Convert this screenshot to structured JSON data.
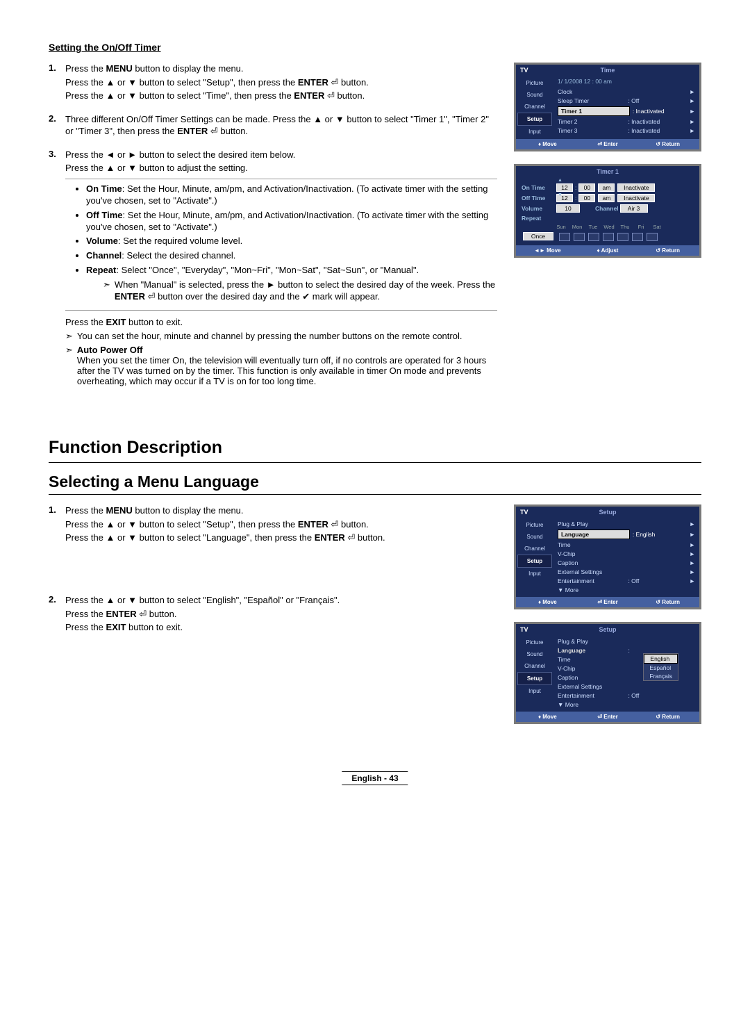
{
  "headings": {
    "setting_timer": "Setting the On/Off Timer",
    "function_description": "Function Description",
    "selecting_language": "Selecting a Menu Language"
  },
  "symbols": {
    "up": "▲",
    "down": "▼",
    "left": "◄",
    "right": "►",
    "enter": "⏎",
    "check": "✔",
    "note": "➣"
  },
  "timer_steps": {
    "s1_num": "1.",
    "s1_l1a": "Press the ",
    "s1_l1b": "MENU",
    "s1_l1c": " button to display the menu.",
    "s1_l2a": "Press the ▲ or ▼ button to select \"Setup\", then press the ",
    "s1_l2b": "ENTER",
    "s1_l2c": " ⏎ button.",
    "s1_l3a": "Press the ▲ or ▼ button to select \"Time\", then press the ",
    "s1_l3b": "ENTER",
    "s1_l3c": " ⏎ button.",
    "s2_num": "2.",
    "s2_l1": "Three different On/Off Timer Settings can be made. Press the ▲ or ▼ button to select \"Timer 1\", \"Timer 2\" or \"Timer 3\", then press the ",
    "s2_l1b": "ENTER",
    "s2_l1c": " ⏎ button.",
    "s3_num": "3.",
    "s3_l1": "Press the ◄ or ► button to select the desired item below.",
    "s3_l2": "Press the ▲ or ▼ button to adjust the setting."
  },
  "options": {
    "on_time_b": "On Time",
    "on_time": ": Set the Hour, Minute, am/pm, and Activation/Inactivation. (To activate timer with the setting you've chosen, set to \"Activate\".)",
    "off_time_b": "Off Time",
    "off_time": ": Set the Hour, Minute, am/pm, and Activation/Inactivation. (To activate timer with the setting you've chosen, set to \"Activate\".)",
    "volume_b": "Volume",
    "volume": ": Set the required volume level.",
    "channel_b": "Channel",
    "channel": ": Select the desired channel.",
    "repeat_b": "Repeat",
    "repeat": ": Select \"Once\", \"Everyday\", \"Mon~Fri\", \"Mon~Sat\", \"Sat~Sun\", or \"Manual\".",
    "manual_note": "When \"Manual\" is selected, press the ► button to select the desired day of the week. Press the ",
    "manual_note_b": "ENTER",
    "manual_note_c": " ⏎ button over the desired day and the ✔ mark will appear."
  },
  "after_box": {
    "exit_a": "Press the ",
    "exit_b": "EXIT",
    "exit_c": " button to exit.",
    "note1": "You can set the hour, minute and channel by pressing the number buttons on the remote control.",
    "auto_b": "Auto Power Off",
    "auto": "When you set the timer On, the television will eventually turn off, if no controls are operated for 3 hours after the TV was turned on by the timer. This function is only available in timer On mode and prevents overheating, which may occur if a TV is on for too long time."
  },
  "lang_steps": {
    "s1_num": "1.",
    "s1_l1a": "Press the ",
    "s1_l1b": "MENU",
    "s1_l1c": " button to display the menu.",
    "s1_l2a": "Press the ▲ or ▼ button to select \"Setup\", then press the ",
    "s1_l2b": "ENTER",
    "s1_l2c": " ⏎ button.",
    "s1_l3a": "Press the ▲ or ▼ button to select \"Language\", then press the ",
    "s1_l3b": "ENTER",
    "s1_l3c": " ⏎ button.",
    "s2_num": "2.",
    "s2_l1": "Press the ▲ or ▼ button to select \"English\", \"Español\" or \"Français\".",
    "s2_l2a": "Press the ",
    "s2_l2b": "ENTER",
    "s2_l2c": " ⏎ button.",
    "s2_l3a": "Press the ",
    "s2_l3b": "EXIT",
    "s2_l3c": " button to exit."
  },
  "osd_common": {
    "tv": "TV",
    "sidebar": [
      "Picture",
      "Sound",
      "Channel",
      "Setup",
      "Input"
    ],
    "foot_move": "Move",
    "foot_enter": "Enter",
    "foot_return": "Return",
    "foot_adjust": "Adjust",
    "foot_move_sym1": "♦",
    "foot_move_sym2": "◄►",
    "foot_enter_sym": "⏎",
    "foot_return_sym": "↺"
  },
  "osd_time": {
    "title": "Time",
    "date": "1/  1/2008  12 : 00 am",
    "rows": [
      {
        "lbl": "Clock",
        "val": "",
        "arr": "►"
      },
      {
        "lbl": "Sleep Timer",
        "val": ": Off",
        "arr": "►"
      },
      {
        "lbl": "Timer 1",
        "val": ": Inactivated",
        "arr": "►",
        "hl": true
      },
      {
        "lbl": "Timer 2",
        "val": ": Inactivated",
        "arr": "►"
      },
      {
        "lbl": "Timer 3",
        "val": ": Inactivated",
        "arr": "►"
      }
    ]
  },
  "osd_timer1": {
    "title": "Timer 1",
    "on_time": {
      "lbl": "On Time",
      "h": "12",
      "m": "00",
      "ap": "am",
      "act": "Inactivate"
    },
    "off_time": {
      "lbl": "Off Time",
      "h": "12",
      "m": "00",
      "ap": "am",
      "act": "Inactivate"
    },
    "volume_lbl": "Volume",
    "volume": "10",
    "channel_lbl": "Channel",
    "channel": "Air  3",
    "repeat_lbl": "Repeat",
    "repeat": "Once",
    "days": [
      "Sun",
      "Mon",
      "Tue",
      "Wed",
      "Thu",
      "Fri",
      "Sat"
    ]
  },
  "osd_setup": {
    "title": "Setup",
    "rows": [
      {
        "lbl": "Plug & Play",
        "val": "",
        "arr": "►"
      },
      {
        "lbl": "Language",
        "val": ": English",
        "arr": "►",
        "hl": true
      },
      {
        "lbl": "Time",
        "val": "",
        "arr": "►"
      },
      {
        "lbl": "V-Chip",
        "val": "",
        "arr": "►"
      },
      {
        "lbl": "Caption",
        "val": "",
        "arr": "►"
      },
      {
        "lbl": "External Settings",
        "val": "",
        "arr": "►"
      },
      {
        "lbl": "Entertainment",
        "val": ": Off",
        "arr": "►"
      },
      {
        "lbl": "▼ More",
        "val": "",
        "arr": ""
      }
    ],
    "lang_options": [
      "English",
      "Español",
      "Français"
    ]
  },
  "footer": "English - 43"
}
